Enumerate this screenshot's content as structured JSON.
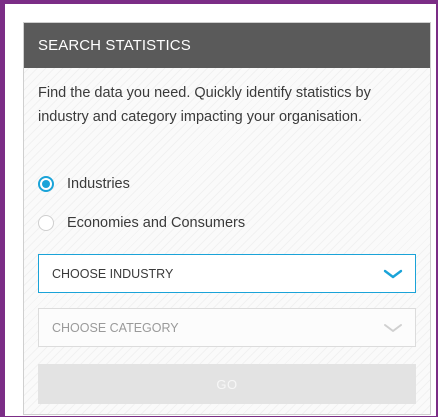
{
  "widget": {
    "title": "SEARCH STATISTICS",
    "description": "Find the data you need. Quickly identify statistics by industry and category impacting your organisation.",
    "radio_options": [
      {
        "label": "Industries",
        "checked": true
      },
      {
        "label": "Economies and Consumers",
        "checked": false
      }
    ],
    "industry_select": {
      "value": "CHOOSE INDUSTRY",
      "enabled": true
    },
    "category_select": {
      "value": "CHOOSE CATEGORY",
      "enabled": false
    },
    "go_label": "GO"
  },
  "colors": {
    "frame_border": "#7b2d86",
    "header_bg": "#5a5a5a",
    "accent": "#1aa3d8",
    "disabled_button": "#e3e3e3"
  },
  "icons": {
    "select_arrow": "chevron-down-icon",
    "radio_on": "radio-checked-icon",
    "radio_off": "radio-unchecked-icon"
  }
}
